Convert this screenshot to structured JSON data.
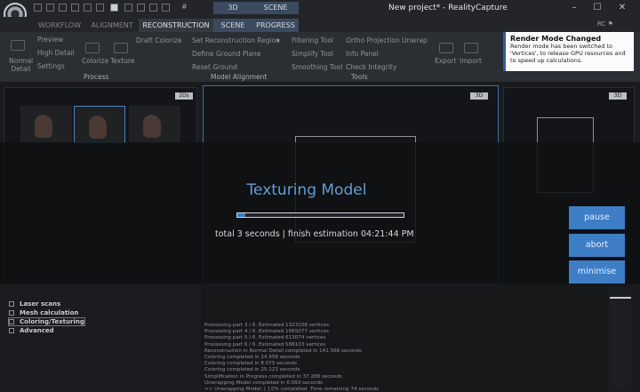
{
  "titlebar": {
    "title": "New project* - RealityCapture",
    "hash": "#",
    "context_tabs": [
      "3D",
      "SCENE"
    ],
    "window_controls": [
      "minimize-icon",
      "maximize-icon",
      "close-icon"
    ]
  },
  "tabs": [
    "WORKFLOW",
    "ALIGNMENT",
    "RECONSTRUCTION",
    "SCENE",
    "PROGRESS"
  ],
  "active_tab": "RECONSTRUCTION",
  "ribbon": {
    "process": {
      "label": "Process",
      "normal_detail": [
        "Normal",
        "Detail"
      ],
      "items": [
        "Preview",
        "High Detail",
        "Settings"
      ],
      "colorize": "Colorize",
      "texture": "Texture",
      "draft_colorize": "Draft Colorize"
    },
    "model_alignment": {
      "label": "Model Alignment",
      "items": [
        "Set Reconstruction Region",
        "Define Ground Plane",
        "Reset Ground"
      ]
    },
    "tools": {
      "label": "Tools",
      "col1": [
        "Filtering Tool",
        "Simplify Tool",
        "Smoothing Tool"
      ],
      "col2": [
        "Ortho Projection",
        "Info Panel",
        "Check Integrity"
      ],
      "unwrap": "Unwrap",
      "export": "Export",
      "import": "Import"
    }
  },
  "notification": {
    "title": "Render Mode Changed",
    "message": "Render mode has been switched to 'Vertices', to release GPU resources and to speed up calculations."
  },
  "viewports": {
    "left_tag": "2Ds",
    "center_tag": "3D",
    "right_tag": "3D"
  },
  "progress": {
    "title": "Texturing Model",
    "status": "total 3 seconds | finish estimation 04:21:44 PM",
    "fraction": 0.05,
    "buttons": {
      "pause": "pause",
      "abort": "abort",
      "minimise": "minimise"
    }
  },
  "sidebar": {
    "items": [
      "Laser scans",
      "Mesh calculation",
      "Coloring/Texturing",
      "Advanced"
    ]
  },
  "log": {
    "lines": [
      "Processing part 3 / 6. Estimated 1323158 vertices",
      "Processing part 4 / 6. Estimated 1065077 vertices",
      "Processing part 5 / 6. Estimated 613074 vertices",
      "Processing part 6 / 6. Estimated 588103 vertices",
      "Reconstruction in Normal Detail completed in 141.566 seconds",
      "Coloring completed in 24.958 seconds",
      "Coloring completed in 8.075 seconds",
      "Coloring completed in 25.123 seconds",
      "Simplification in Progress completed in 37.288 seconds",
      "Unwrapping Model completed in 6.093 seconds",
      ">> Unwrapping Model: [                    ] 0% completed. Time remaining 74 seconds"
    ]
  }
}
